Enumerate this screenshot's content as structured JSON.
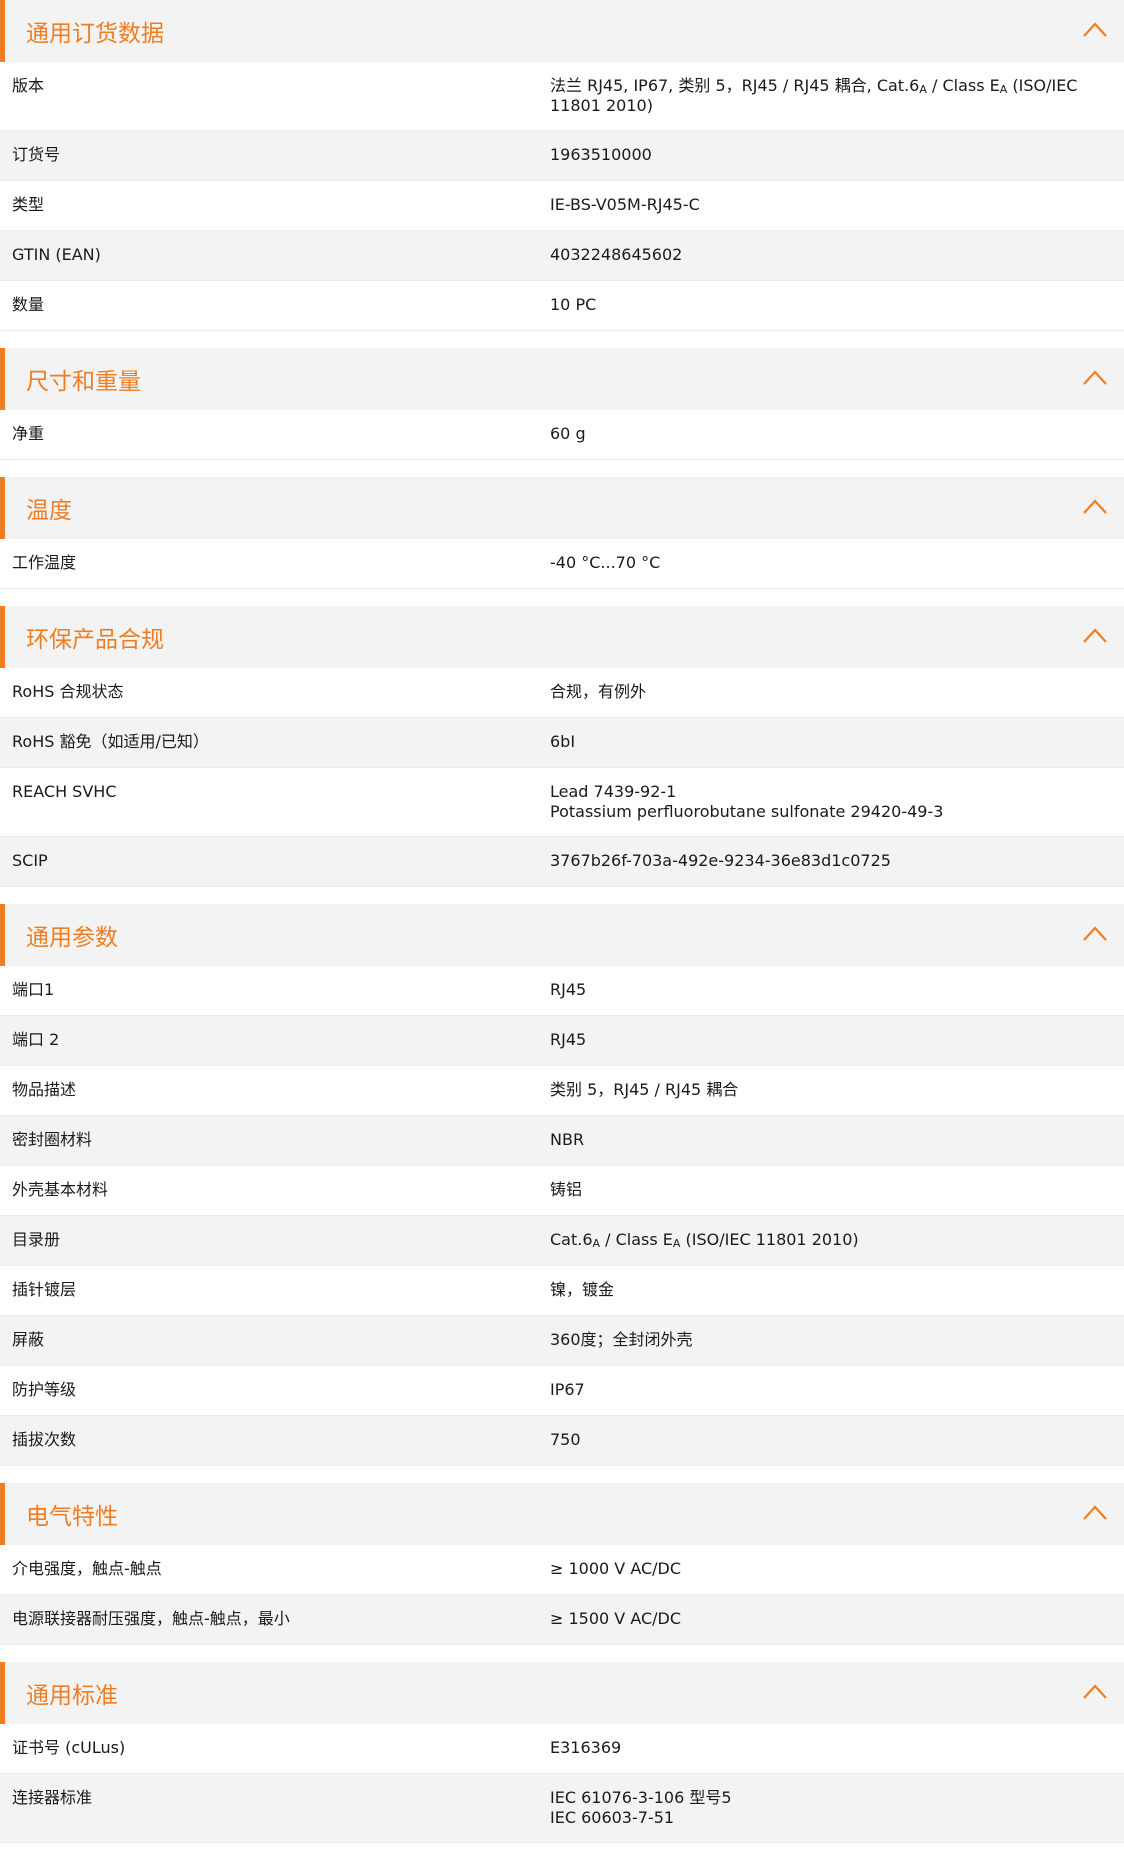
{
  "sections": [
    {
      "id": "ordering",
      "title": "通用订货数据",
      "rows": [
        {
          "label": "版本",
          "lines": [
            [
              "法兰 RJ45, IP67, 类别 5，RJ45 / RJ45 耦合, Cat.6",
              "A",
              " / Class E",
              "A",
              " (ISO/IEC"
            ],
            [
              "11801 2010)"
            ]
          ]
        },
        {
          "label": "订货号",
          "lines": [
            [
              "1963510000"
            ]
          ]
        },
        {
          "label": "类型",
          "lines": [
            [
              "IE-BS-V05M-RJ45-C"
            ]
          ]
        },
        {
          "label": "GTIN (EAN)",
          "lines": [
            [
              "4032248645602"
            ]
          ]
        },
        {
          "label": "数量",
          "lines": [
            [
              "10  PC"
            ]
          ]
        }
      ]
    },
    {
      "id": "dimensions",
      "title": "尺寸和重量",
      "rows": [
        {
          "label": "净重",
          "lines": [
            [
              "60  g"
            ]
          ]
        }
      ]
    },
    {
      "id": "temperature",
      "title": "温度",
      "rows": [
        {
          "label": "工作温度",
          "lines": [
            [
              "-40 °C...70 °C"
            ]
          ]
        }
      ]
    },
    {
      "id": "compliance",
      "title": "环保产品合规",
      "rows": [
        {
          "label": "RoHS 合规状态",
          "lines": [
            [
              "合规，有例外"
            ]
          ]
        },
        {
          "label": "RoHS 豁免（如适用/已知）",
          "lines": [
            [
              "6bI"
            ]
          ]
        },
        {
          "label": "REACH SVHC",
          "lines": [
            [
              "Lead 7439-92-1"
            ],
            [
              "Potassium perfluorobutane sulfonate 29420-49-3"
            ]
          ]
        },
        {
          "label": "SCIP",
          "lines": [
            [
              "3767b26f-703a-492e-9234-36e83d1c0725"
            ]
          ]
        }
      ]
    },
    {
      "id": "general",
      "title": "通用参数",
      "rows": [
        {
          "label": "端口1",
          "lines": [
            [
              "RJ45"
            ]
          ]
        },
        {
          "label": "端口 2",
          "lines": [
            [
              "RJ45"
            ]
          ]
        },
        {
          "label": "物品描述",
          "lines": [
            [
              "类别 5，RJ45 / RJ45 耦合"
            ]
          ]
        },
        {
          "label": "密封圈材料",
          "lines": [
            [
              "NBR"
            ]
          ]
        },
        {
          "label": "外壳基本材料",
          "lines": [
            [
              "铸铝"
            ]
          ]
        },
        {
          "label": "目录册",
          "lines": [
            [
              "Cat.6",
              "A",
              " / Class E",
              "A",
              " (ISO/IEC 11801 2010)"
            ]
          ]
        },
        {
          "label": "插针镀层",
          "lines": [
            [
              "镍，镀金"
            ]
          ]
        },
        {
          "label": "屏蔽",
          "lines": [
            [
              "360度；全封闭外壳"
            ]
          ]
        },
        {
          "label": "防护等级",
          "lines": [
            [
              "IP67"
            ]
          ]
        },
        {
          "label": "插拔次数",
          "lines": [
            [
              "750"
            ]
          ]
        }
      ]
    },
    {
      "id": "electrical",
      "title": "电气特性",
      "rows": [
        {
          "label": "介电强度，触点-触点",
          "lines": [
            [
              "≥ 1000 V AC/DC"
            ]
          ]
        },
        {
          "label": "电源联接器耐压强度，触点-触点，最小",
          "lines": [
            [
              "≥ 1500 V AC/DC"
            ]
          ]
        }
      ]
    },
    {
      "id": "standards",
      "title": "通用标准",
      "rows": [
        {
          "label": "证书号 (cULus)",
          "lines": [
            [
              "E316369"
            ]
          ]
        },
        {
          "label": "连接器标准",
          "lines": [
            [
              "IEC 61076-3-106 型号5"
            ],
            [
              "IEC 60603-7-51"
            ]
          ]
        }
      ]
    }
  ],
  "colors": {
    "accent": "#ef7d22",
    "header_bg": "#f3f3f3",
    "row_alt": "#f3f3f3"
  },
  "icons": {
    "collapse": "chevron-up-icon"
  }
}
